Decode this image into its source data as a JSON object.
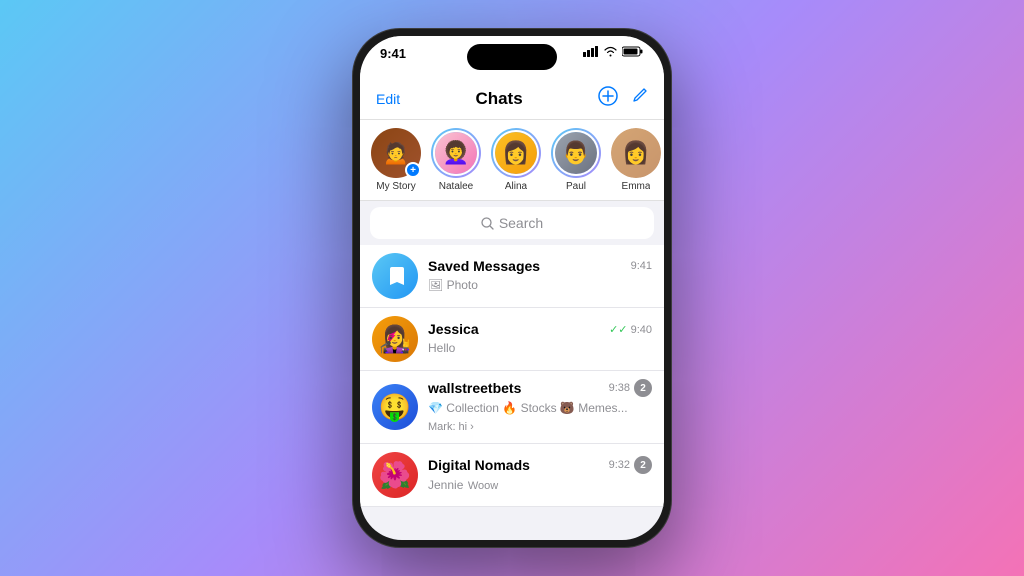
{
  "background": {
    "gradient": "135deg, #5bc8f5 0%, #a78bfa 50%, #f472b6 100%"
  },
  "statusBar": {
    "time": "9:41",
    "signal": "▐▐▐",
    "wifi": "wifi",
    "battery": "battery"
  },
  "navbar": {
    "editLabel": "Edit",
    "title": "Chats",
    "newGroupIcon": "⊕",
    "editIcon": "✏"
  },
  "stories": [
    {
      "name": "My Story",
      "hasPlus": true,
      "color": "#8b4513",
      "emoji": "👩"
    },
    {
      "name": "Natalee",
      "hasRing": true,
      "color": "#f9a8d4",
      "emoji": "👩‍🦱"
    },
    {
      "name": "Alina",
      "hasRing": true,
      "color": "#f59e0b",
      "emoji": "👩"
    },
    {
      "name": "Paul",
      "hasRing": true,
      "color": "#6b7280",
      "emoji": "👨"
    },
    {
      "name": "Emma",
      "hasRing": false,
      "color": "#d4a574",
      "emoji": "👩"
    }
  ],
  "search": {
    "placeholder": "Search"
  },
  "chats": [
    {
      "id": "saved-messages",
      "name": "Saved Messages",
      "preview": "🖼 Photo",
      "time": "9:41",
      "avatarType": "bookmark",
      "avatarColor": "#2196f3",
      "badge": null,
      "doubleCheck": false,
      "preview2": null
    },
    {
      "id": "jessica",
      "name": "Jessica",
      "preview": "Hello",
      "time": "9:40",
      "avatarType": "emoji",
      "avatarEmoji": "👩‍🎤",
      "avatarColor": "#f59e0b",
      "badge": null,
      "doubleCheck": true,
      "preview2": null
    },
    {
      "id": "wallstreetbets",
      "name": "wallstreetbets",
      "preview": "💎 Collection 🔥 Stocks 🐻 Memes...",
      "time": "9:38",
      "avatarType": "emoji",
      "avatarEmoji": "🤑",
      "avatarColor": "#3b82f6",
      "badge": "2",
      "doubleCheck": false,
      "preview2": "Mark: hi ›"
    },
    {
      "id": "digital-nomads",
      "name": "Digital Nomads",
      "preview": "Jennie",
      "preview2": "Woow",
      "time": "9:32",
      "avatarType": "emoji",
      "avatarEmoji": "🌺",
      "avatarColor": "#ef4444",
      "badge": "2",
      "doubleCheck": false
    }
  ]
}
